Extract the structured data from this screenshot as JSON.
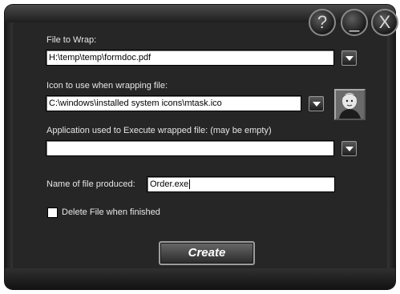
{
  "window": {
    "caption_buttons": [
      {
        "name": "help-button",
        "glyph": "?"
      },
      {
        "name": "minimize-button",
        "glyph": "_"
      },
      {
        "name": "close-button",
        "glyph": "X"
      }
    ]
  },
  "file_to_wrap": {
    "label": "File to Wrap:",
    "value": "H:\\temp\\temp\\formdoc.pdf"
  },
  "icon_file": {
    "label": "Icon to use when wrapping file:",
    "value": "C:\\windows\\installed system icons\\mtask.ico"
  },
  "application": {
    "label": "Application used to Execute wrapped file: (may be empty)",
    "value": ""
  },
  "output_name": {
    "label": "Name of file produced:",
    "value": "Order.exe"
  },
  "delete_option": {
    "label": "Delete File when finished",
    "checked": false
  },
  "create_button": {
    "label": "Create"
  }
}
